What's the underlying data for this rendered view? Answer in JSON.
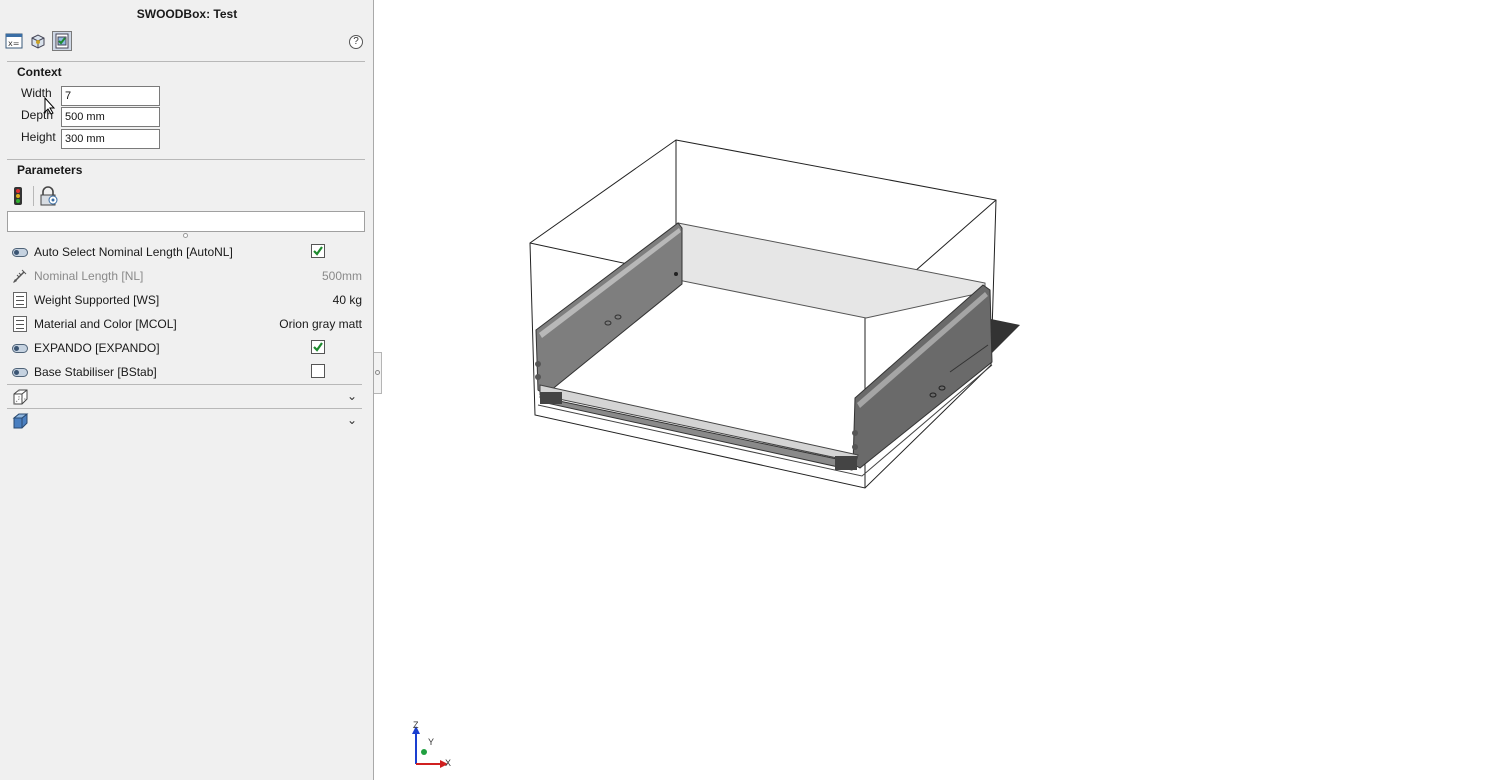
{
  "window": {
    "title": "SWOODBox: Test"
  },
  "toolbar": {
    "buttons": [
      {
        "icon": "variables-icon",
        "active": false
      },
      {
        "icon": "box-3d-icon",
        "active": false
      },
      {
        "icon": "parameters-sheet-icon",
        "active": true
      }
    ],
    "help_icon": "question-icon"
  },
  "context": {
    "title": "Context",
    "fields": [
      {
        "label": "Width",
        "value": "7"
      },
      {
        "label": "Depth",
        "value": "500 mm"
      },
      {
        "label": "Height",
        "value": "300 mm"
      }
    ]
  },
  "parameters": {
    "title": "Parameters",
    "filter_value": "",
    "items": [
      {
        "label": "Auto Select Nominal Length [AutoNL]",
        "type": "boolean",
        "checked": true,
        "icon": "toggle-icon"
      },
      {
        "label": "Nominal Length [NL]",
        "type": "value",
        "value": "500mm",
        "icon": "length-icon",
        "disabled": true
      },
      {
        "label": "Weight Supported [WS]",
        "type": "value",
        "value": "40 kg",
        "icon": "list-icon"
      },
      {
        "label": "Material and Color [MCOL]",
        "type": "value",
        "value": "Orion gray matt",
        "icon": "list-icon"
      },
      {
        "label": "EXPANDO [EXPANDO]",
        "type": "boolean",
        "checked": true,
        "icon": "toggle-icon"
      },
      {
        "label": "Base Stabiliser [BStab]",
        "type": "boolean",
        "checked": false,
        "icon": "toggle-icon"
      }
    ],
    "groups": [
      {
        "icon": "wireframe-box-icon",
        "label": ""
      },
      {
        "icon": "solid-box-icon",
        "label": ""
      }
    ]
  },
  "triad": {
    "x": "X",
    "y": "Y",
    "z": "Z"
  },
  "colors": {
    "panel_bg": "#f0f0f0",
    "check_green": "#1e8a2e",
    "drawer_gray": "#5a5a5a"
  }
}
